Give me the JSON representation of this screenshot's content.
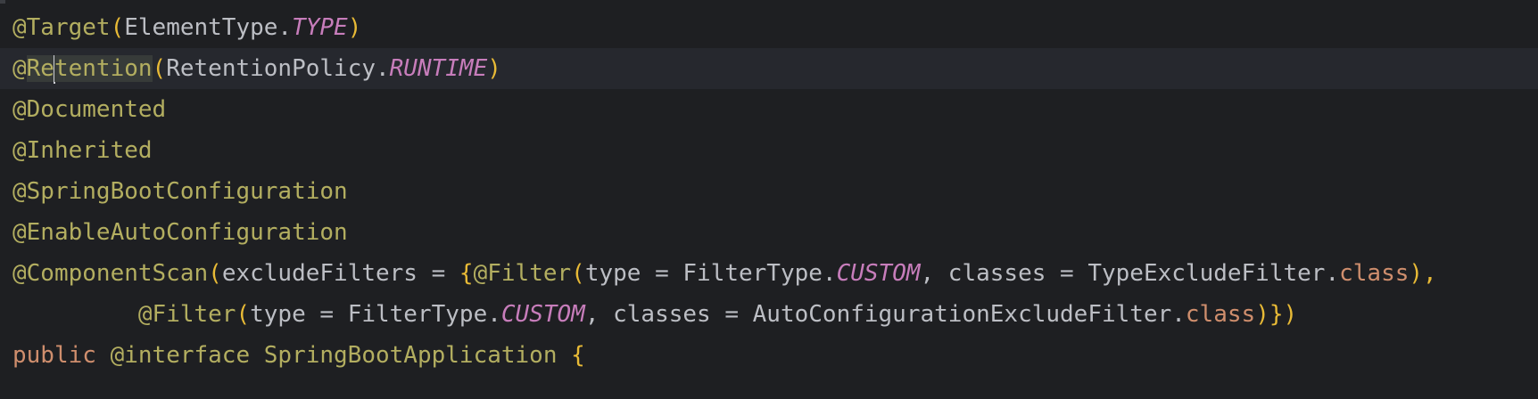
{
  "editor": {
    "lines": [
      {
        "tokens": [
          {
            "t": "@Target",
            "c": "ann"
          },
          {
            "t": "(",
            "c": "brace"
          },
          {
            "t": "ElementType.",
            "c": "plain"
          },
          {
            "t": "TYPE",
            "c": "const"
          },
          {
            "t": ")",
            "c": "brace"
          }
        ]
      },
      {
        "tokens": [
          {
            "t": "@",
            "c": "ann"
          },
          {
            "t": "Re",
            "c": "ann hl"
          },
          {
            "caret": true
          },
          {
            "t": "tention",
            "c": "ann hl"
          },
          {
            "t": "(",
            "c": "brace"
          },
          {
            "t": "RetentionPolicy.",
            "c": "plain"
          },
          {
            "t": "RUNTIME",
            "c": "const"
          },
          {
            "t": ")",
            "c": "brace"
          }
        ]
      },
      {
        "tokens": [
          {
            "t": "@Documented",
            "c": "ann"
          }
        ]
      },
      {
        "tokens": [
          {
            "t": "@Inherited",
            "c": "ann"
          }
        ]
      },
      {
        "tokens": [
          {
            "t": "@SpringBootConfiguration",
            "c": "ann"
          }
        ]
      },
      {
        "tokens": [
          {
            "t": "@EnableAutoConfiguration",
            "c": "ann"
          }
        ]
      },
      {
        "tokens": [
          {
            "t": "@ComponentScan",
            "c": "ann"
          },
          {
            "t": "(",
            "c": "brace"
          },
          {
            "t": "excludeFilters = ",
            "c": "plain"
          },
          {
            "t": "{",
            "c": "brace"
          },
          {
            "t": "@Filter",
            "c": "ann"
          },
          {
            "t": "(",
            "c": "brace"
          },
          {
            "t": "type = FilterType.",
            "c": "plain"
          },
          {
            "t": "CUSTOM",
            "c": "const"
          },
          {
            "t": ", classes = TypeExcludeFilter.",
            "c": "plain"
          },
          {
            "t": "class",
            "c": "kw"
          },
          {
            "t": "),",
            "c": "brace"
          }
        ]
      },
      {
        "tokens": [
          {
            "t": "         ",
            "c": "plain"
          },
          {
            "t": "@Filter",
            "c": "ann"
          },
          {
            "t": "(",
            "c": "brace"
          },
          {
            "t": "type = FilterType.",
            "c": "plain"
          },
          {
            "t": "CUSTOM",
            "c": "const"
          },
          {
            "t": ", classes = AutoConfigurationExcludeFilter.",
            "c": "plain"
          },
          {
            "t": "class",
            "c": "kw"
          },
          {
            "t": ")})",
            "c": "brace"
          }
        ]
      },
      {
        "tokens": [
          {
            "t": "public ",
            "c": "kw"
          },
          {
            "t": "@interface ",
            "c": "ann"
          },
          {
            "t": "SpringBootApplication ",
            "c": "ann"
          },
          {
            "t": "{",
            "c": "brace"
          }
        ]
      }
    ]
  },
  "colors": {
    "background": "#1e1f22",
    "current_line": "#26282e",
    "annotation": "#b3ae60",
    "keyword": "#cf8e6d",
    "constant": "#c77dbb",
    "brace": "#e8ba36",
    "plain": "#bcbec4"
  }
}
